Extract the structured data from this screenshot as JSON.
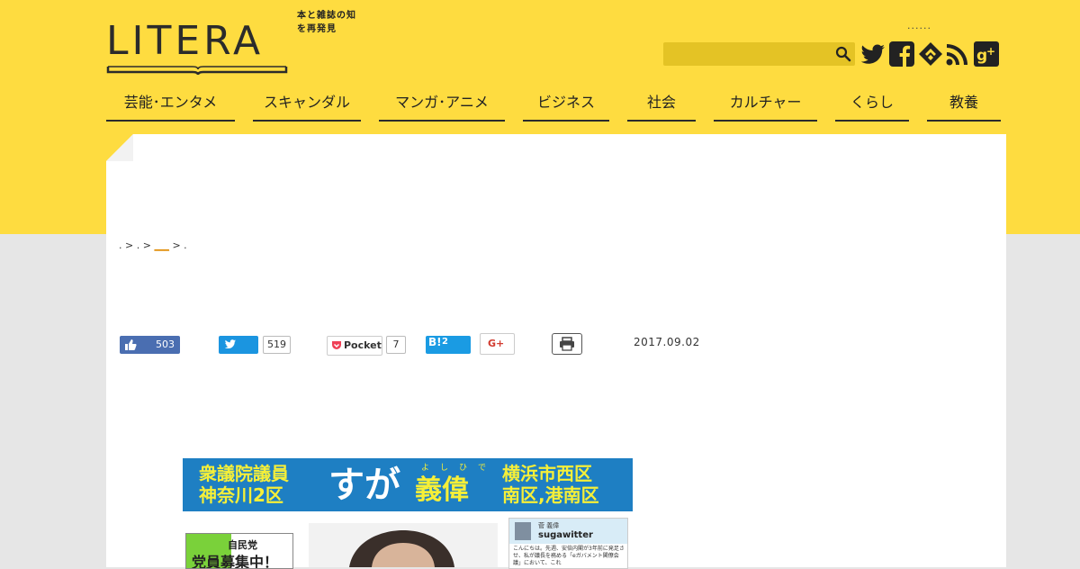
{
  "header": {
    "logo_text": "LITERA",
    "tagline": "本と雑誌の知を再発見",
    "top_dots": "......",
    "search": {
      "placeholder": "",
      "value": ""
    },
    "social": [
      "twitter-icon",
      "facebook-icon",
      "feedly-icon",
      "rss-icon",
      "google-plus-icon"
    ]
  },
  "nav": {
    "items": [
      {
        "label": "芸能･エンタメ"
      },
      {
        "label": "スキャンダル"
      },
      {
        "label": "マンガ･アニメ"
      },
      {
        "label": "ビジネス"
      },
      {
        "label": "社会"
      },
      {
        "label": "カルチャー"
      },
      {
        "label": "くらし"
      },
      {
        "label": "教養"
      }
    ]
  },
  "breadcrumb": {
    "items": [
      ".",
      ".",
      "___",
      "."
    ],
    "separator": ">"
  },
  "share": {
    "facebook_count": "503",
    "twitter_count": "519",
    "pocket_label": "Pocket",
    "pocket_count": "7",
    "hatena_label": "B!",
    "hatena_count": "2",
    "gplus_label": "G+"
  },
  "article": {
    "date": "2017.09.02"
  },
  "banner": {
    "line1_left": "衆議院議員",
    "line2_left": "神奈川2区",
    "big_text": "すが",
    "name": "義偉",
    "ruby": "よしひで",
    "line1_right": "横浜市西区",
    "line2_right": "南区,港南区"
  },
  "recruit": {
    "party": "自民党",
    "text": "党員募集中！"
  },
  "tweet_card": {
    "user": "菅 義偉",
    "handle": "sugawitter",
    "body": "こんにちは。先週、安倍内閣が3年前に発足させ、私が議長を務める「eガバメント閣僚会議」において、これ"
  },
  "colors": {
    "brand_yellow": "#fedc40",
    "search_bg": "#e4c325",
    "facebook": "#4a6eb1",
    "twitter": "#1b95e0",
    "hatena": "#1a9be3",
    "banner_blue": "#1e7fc3",
    "banner_yellow": "#f6ef38"
  }
}
